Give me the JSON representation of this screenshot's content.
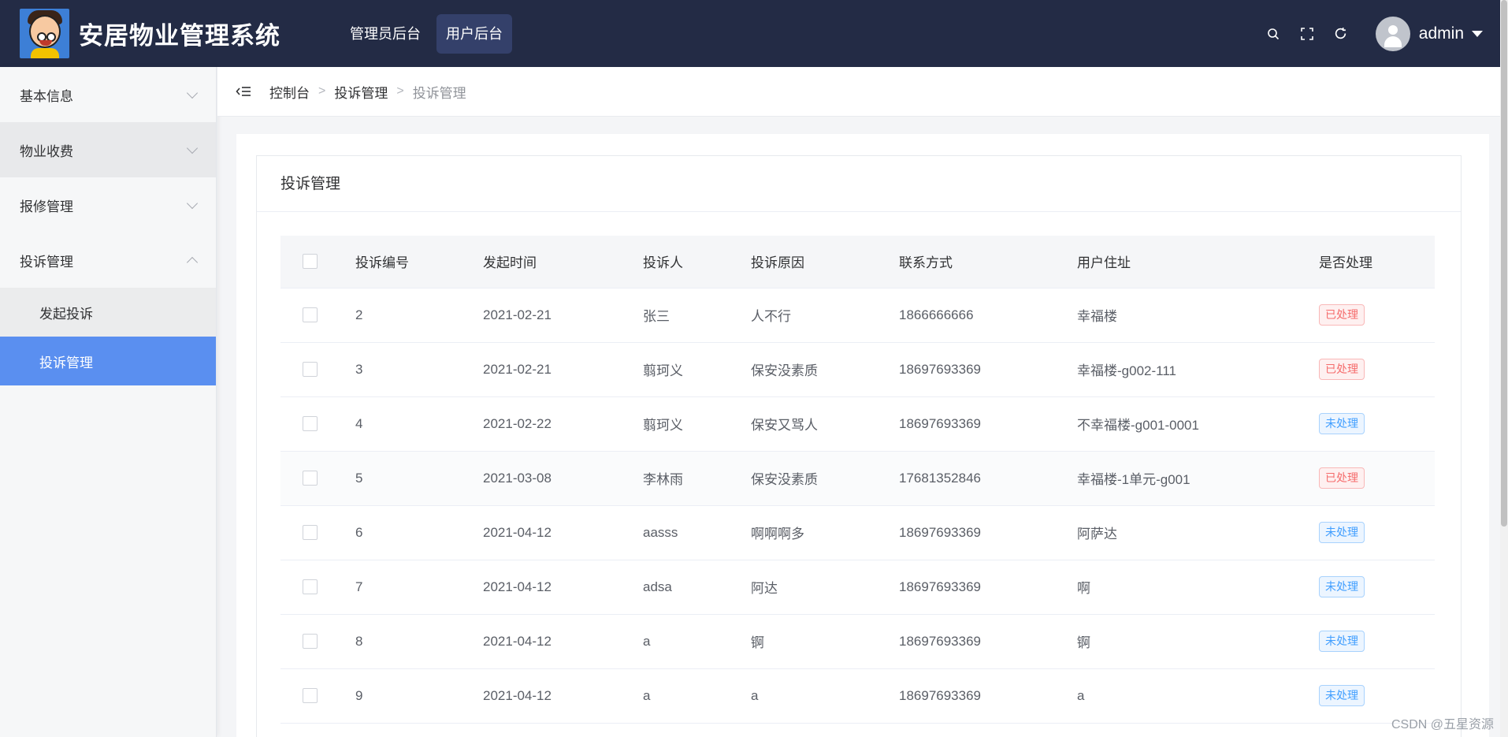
{
  "app": {
    "title": "安居物业管理系统",
    "logo_icon": "cartoon-mascot-logo"
  },
  "top_nav": [
    {
      "label": "管理员后台",
      "active": false
    },
    {
      "label": "用户后台",
      "active": true
    }
  ],
  "header_tools": {
    "search_icon": "search-icon",
    "fullscreen_icon": "fullscreen-icon",
    "refresh_icon": "refresh-icon",
    "username": "admin"
  },
  "sidebar": {
    "items": [
      {
        "label": "基本信息",
        "expanded": false
      },
      {
        "label": "物业收费",
        "expanded": false
      },
      {
        "label": "报修管理",
        "expanded": false
      },
      {
        "label": "投诉管理",
        "expanded": true
      }
    ],
    "sub_items": [
      {
        "label": "发起投诉",
        "active": false
      },
      {
        "label": "投诉管理",
        "active": true
      }
    ]
  },
  "breadcrumb": [
    "控制台",
    "投诉管理",
    "投诉管理"
  ],
  "card": {
    "title": "投诉管理"
  },
  "table": {
    "columns": [
      "投诉编号",
      "发起时间",
      "投诉人",
      "投诉原因",
      "联系方式",
      "用户住址",
      "是否处理"
    ],
    "rows": [
      {
        "id": "2",
        "date": "2021-02-21",
        "person": "张三",
        "reason": "人不行",
        "phone": "1866666666",
        "address": "幸福楼",
        "status": "已处理"
      },
      {
        "id": "3",
        "date": "2021-02-21",
        "person": "翦珂义",
        "reason": "保安没素质",
        "phone": "18697693369",
        "address": "幸福楼-g002-111",
        "status": "已处理"
      },
      {
        "id": "4",
        "date": "2021-02-22",
        "person": "翦珂义",
        "reason": "保安又骂人",
        "phone": "18697693369",
        "address": "不幸福楼-g001-0001",
        "status": "未处理"
      },
      {
        "id": "5",
        "date": "2021-03-08",
        "person": "李林雨",
        "reason": "保安没素质",
        "phone": "17681352846",
        "address": "幸福楼-1单元-g001",
        "status": "已处理"
      },
      {
        "id": "6",
        "date": "2021-04-12",
        "person": "aasss",
        "reason": "啊啊啊多",
        "phone": "18697693369",
        "address": "阿萨达",
        "status": "未处理"
      },
      {
        "id": "7",
        "date": "2021-04-12",
        "person": "adsa",
        "reason": "阿达",
        "phone": "18697693369",
        "address": "啊",
        "status": "未处理"
      },
      {
        "id": "8",
        "date": "2021-04-12",
        "person": "a",
        "reason": "锕",
        "phone": "18697693369",
        "address": "锕",
        "status": "未处理"
      },
      {
        "id": "9",
        "date": "2021-04-12",
        "person": "a",
        "reason": "a",
        "phone": "18697693369",
        "address": "a",
        "status": "未处理"
      }
    ]
  },
  "colors": {
    "header_bg": "#232b45",
    "accent": "#5a8ff0",
    "done_tag": "#f56c6c",
    "todo_tag": "#409eff"
  },
  "watermark": "CSDN @五星资源"
}
